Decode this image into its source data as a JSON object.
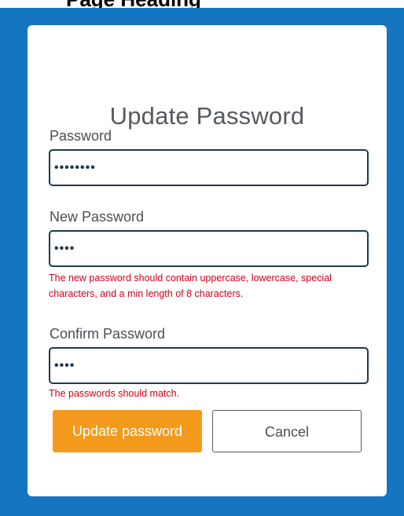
{
  "header_fragment": "Page Heading",
  "form": {
    "title": "Update Password",
    "password": {
      "label": "Password",
      "value": "••••••••"
    },
    "new_password": {
      "label": "New Password",
      "value": "••••",
      "error": "The new password should contain uppercase, lowercase, special characters, and a min length of 8 characters."
    },
    "confirm_password": {
      "label": "Confirm Password",
      "value": "••••",
      "error": "The passwords should match."
    },
    "buttons": {
      "update": "Update password",
      "cancel": "Cancel"
    }
  },
  "colors": {
    "backdrop": "#1575c0",
    "card": "#ffffff",
    "primary_button": "#f39a1d",
    "error": "#d0001a",
    "input_border": "#1f3a4d"
  }
}
